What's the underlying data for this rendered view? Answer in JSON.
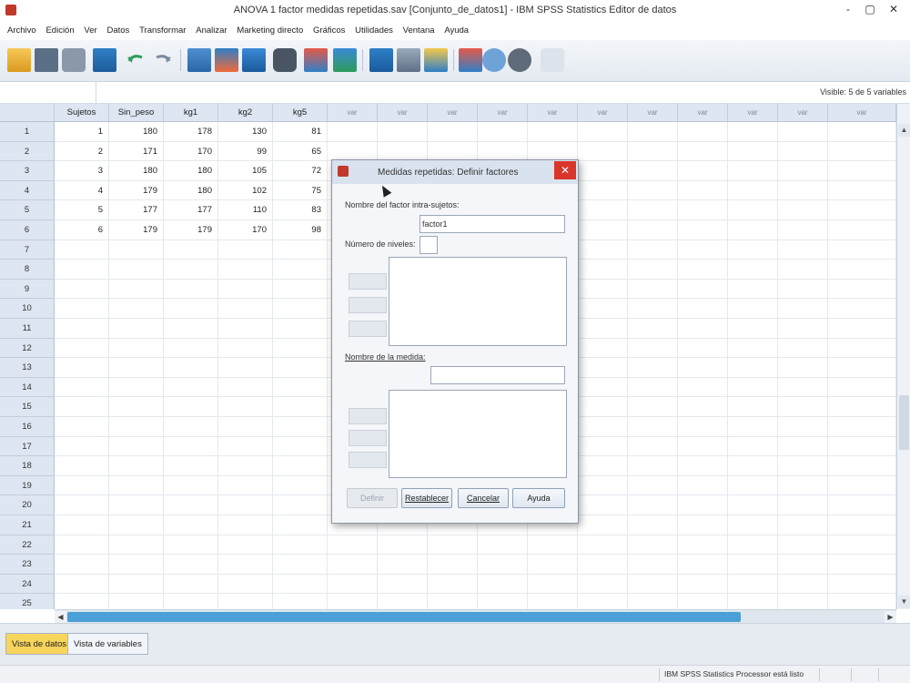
{
  "window": {
    "title": "ANOVA 1 factor medidas repetidas.sav [Conjunto_de_datos1] - IBM SPSS Statistics Editor de datos",
    "minimize": "-",
    "restore": "▢",
    "close": "✕"
  },
  "menu": [
    "Archivo",
    "Edición",
    "Ver",
    "Datos",
    "Transformar",
    "Analizar",
    "Marketing directo",
    "Gráficos",
    "Utilidades",
    "Ventana",
    "Ayuda"
  ],
  "cellbar": {
    "visible": "Visible: 5 de 5 variables"
  },
  "grid": {
    "columns": [
      "Sujetos",
      "Sin_peso",
      "kg1",
      "kg2",
      "kg5",
      "var",
      "var",
      "var",
      "var",
      "var",
      "var",
      "var",
      "var",
      "var",
      "var",
      "var"
    ],
    "row_numbers": [
      "1",
      "2",
      "3",
      "4",
      "5",
      "6",
      "7",
      "8",
      "9",
      "10",
      "11",
      "12",
      "13",
      "14",
      "15",
      "16",
      "17",
      "18",
      "19",
      "20",
      "21",
      "22",
      "23",
      "24",
      "25"
    ],
    "rows": [
      [
        "1",
        "180",
        "178",
        "130",
        "81"
      ],
      [
        "2",
        "171",
        "170",
        "99",
        "65"
      ],
      [
        "3",
        "180",
        "180",
        "105",
        "72"
      ],
      [
        "4",
        "179",
        "180",
        "102",
        "75"
      ],
      [
        "5",
        "177",
        "177",
        "110",
        "83"
      ],
      [
        "6",
        "179",
        "179",
        "170",
        "98"
      ]
    ]
  },
  "tabs": {
    "data_view": "Vista de datos",
    "variable_view": "Vista de variables"
  },
  "status": "IBM SPSS Statistics Processor está listo",
  "dialog": {
    "title": "Medidas repetidas: Definir factores",
    "close": "✕",
    "factor_label": "Nombre del factor intra-sujetos:",
    "factor_value": "factor1",
    "levels_label": "Número de niveles:",
    "levels_value": "",
    "measure_label": "Nombre de la medida:",
    "measure_value": "",
    "buttons": {
      "define": "Definir",
      "reset": "Restablecer",
      "cancel": "Cancelar",
      "help": "Ayuda"
    }
  }
}
